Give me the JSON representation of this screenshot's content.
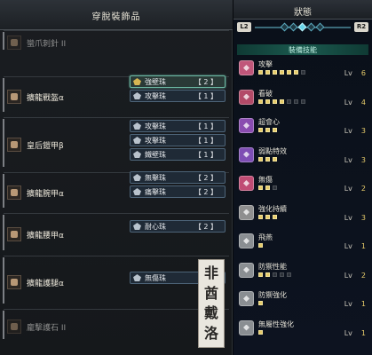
{
  "left_panel": {
    "title": "穿脫裝飾品",
    "equipment": [
      {
        "name": "蠻爪刺針 II",
        "icon": "weapon-icon",
        "dim": true,
        "decorations": []
      },
      {
        "name": "擴龍戰盔α",
        "icon": "helm-icon",
        "dim": false,
        "decorations": [
          {
            "name": "強壁珠",
            "level": "【 2 】",
            "icon": "jewel-icon",
            "selected": true
          },
          {
            "name": "攻擊珠",
            "level": "【 1 】",
            "icon": "jewel-icon",
            "selected": false
          }
        ]
      },
      {
        "name": "皇后鎧甲β",
        "icon": "chest-icon",
        "dim": false,
        "decorations": [
          {
            "name": "攻擊珠",
            "level": "【 1 】",
            "icon": "jewel-icon",
            "selected": false
          },
          {
            "name": "攻擊珠",
            "level": "【 1 】",
            "icon": "jewel-icon",
            "selected": false
          },
          {
            "name": "鐵壁珠",
            "level": "【 1 】",
            "icon": "jewel-icon",
            "selected": false
          }
        ]
      },
      {
        "name": "擴龍腕甲α",
        "icon": "arms-icon",
        "dim": false,
        "decorations": [
          {
            "name": "無擊珠",
            "level": "【 2 】",
            "icon": "jewel-icon",
            "selected": false
          },
          {
            "name": "痛擊珠",
            "level": "【 2 】",
            "icon": "jewel-icon",
            "selected": false
          }
        ]
      },
      {
        "name": "擴龍腰甲α",
        "icon": "waist-icon",
        "dim": false,
        "decorations": [
          {
            "name": "耐心珠",
            "level": "【 2 】",
            "icon": "jewel-icon",
            "selected": false
          }
        ]
      },
      {
        "name": "擴龍護腿α",
        "icon": "legs-icon",
        "dim": false,
        "decorations": [
          {
            "name": "無傷珠",
            "level": "【 2 】",
            "icon": "jewel-icon",
            "selected": false
          }
        ]
      },
      {
        "name": "龐擊護石 II",
        "icon": "charm-icon",
        "dim": true,
        "decorations": []
      }
    ],
    "watermark": [
      "非",
      "酋",
      "戴",
      "洛"
    ]
  },
  "right_panel": {
    "title": "狀態",
    "left_shoulder": "L2",
    "right_shoulder": "R2",
    "tab_count": 5,
    "active_tab": 2,
    "section_title": "裝備技能",
    "skills": [
      {
        "name": "攻擊",
        "icon": "attack-icon",
        "icon_color": "#c0567a",
        "filled": 6,
        "max": 7,
        "lv_label": "Lv",
        "lv": "6",
        "lv_color": "max"
      },
      {
        "name": "看破",
        "icon": "critical-eye-icon",
        "icon_color": "#b34a68",
        "filled": 4,
        "max": 7,
        "lv_label": "Lv",
        "lv": "4",
        "lv_color": "mid"
      },
      {
        "name": "超會心",
        "icon": "critical-boost-icon",
        "icon_color": "#8a4cb0",
        "filled": 3,
        "max": 3,
        "lv_label": "Lv",
        "lv": "3",
        "lv_color": "max"
      },
      {
        "name": "弱點特效",
        "icon": "weakness-exploit-icon",
        "icon_color": "#7e4eb4",
        "filled": 3,
        "max": 3,
        "lv_label": "Lv",
        "lv": "3",
        "lv_color": "max"
      },
      {
        "name": "無傷",
        "icon": "peak-performance-icon",
        "icon_color": "#c04c74",
        "filled": 2,
        "max": 3,
        "lv_label": "Lv",
        "lv": "2",
        "lv_color": "mid"
      },
      {
        "name": "強化持續",
        "icon": "maximum-might-icon",
        "icon_color": "#8f8f8f",
        "filled": 3,
        "max": 3,
        "lv_label": "Lv",
        "lv": "3",
        "lv_color": "max"
      },
      {
        "name": "飛燕",
        "icon": "airborne-icon",
        "icon_color": "#8a8e92",
        "filled": 1,
        "max": 1,
        "lv_label": "Lv",
        "lv": "1",
        "lv_color": "max"
      },
      {
        "name": "防禦性能",
        "icon": "guard-icon",
        "icon_color": "#8a8e92",
        "filled": 2,
        "max": 5,
        "lv_label": "Lv",
        "lv": "2",
        "lv_color": "mid"
      },
      {
        "name": "防禦強化",
        "icon": "guard-up-icon",
        "icon_color": "#8a8e92",
        "filled": 1,
        "max": 1,
        "lv_label": "Lv",
        "lv": "1",
        "lv_color": "max"
      },
      {
        "name": "無屬性強化",
        "icon": "non-elemental-boost-icon",
        "icon_color": "#8a8e92",
        "filled": 1,
        "max": 1,
        "lv_label": "Lv",
        "lv": "1",
        "lv_color": "max"
      }
    ]
  }
}
